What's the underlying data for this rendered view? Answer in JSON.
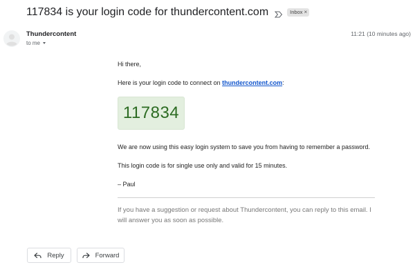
{
  "email": {
    "subject": "117834 is your login code for thundercontent.com",
    "label_chip": "Inbox",
    "label_chip_close": "×",
    "sender_name": "Thundercontent",
    "recipient_text": "to me",
    "timestamp": "11:21 (10 minutes ago)"
  },
  "body": {
    "greeting": "Hi there,",
    "intro_prefix": "Here is your login code to connect on ",
    "intro_link": "thundercontent.com",
    "intro_suffix": ":",
    "code": "117834",
    "line1": "We are now using this easy login system to save you from having to remember a password.",
    "line2": "This login code is for single use only and valid for 15 minutes.",
    "signature": "– Paul",
    "footer": "If you have a suggestion or request about Thundercontent, you can reply to this email. I will answer you as soon as possible."
  },
  "actions": {
    "reply_label": "Reply",
    "forward_label": "Forward"
  },
  "icons": {
    "importance": "importance-marker-icon",
    "avatar": "default-avatar-icon",
    "reply": "reply-arrow-icon",
    "forward": "forward-arrow-icon",
    "caret": "chevron-down-icon"
  },
  "colors": {
    "link": "#1155cc",
    "code_background": "#e3efdf",
    "code_text": "#2c6b22",
    "footer_text": "#777777"
  }
}
